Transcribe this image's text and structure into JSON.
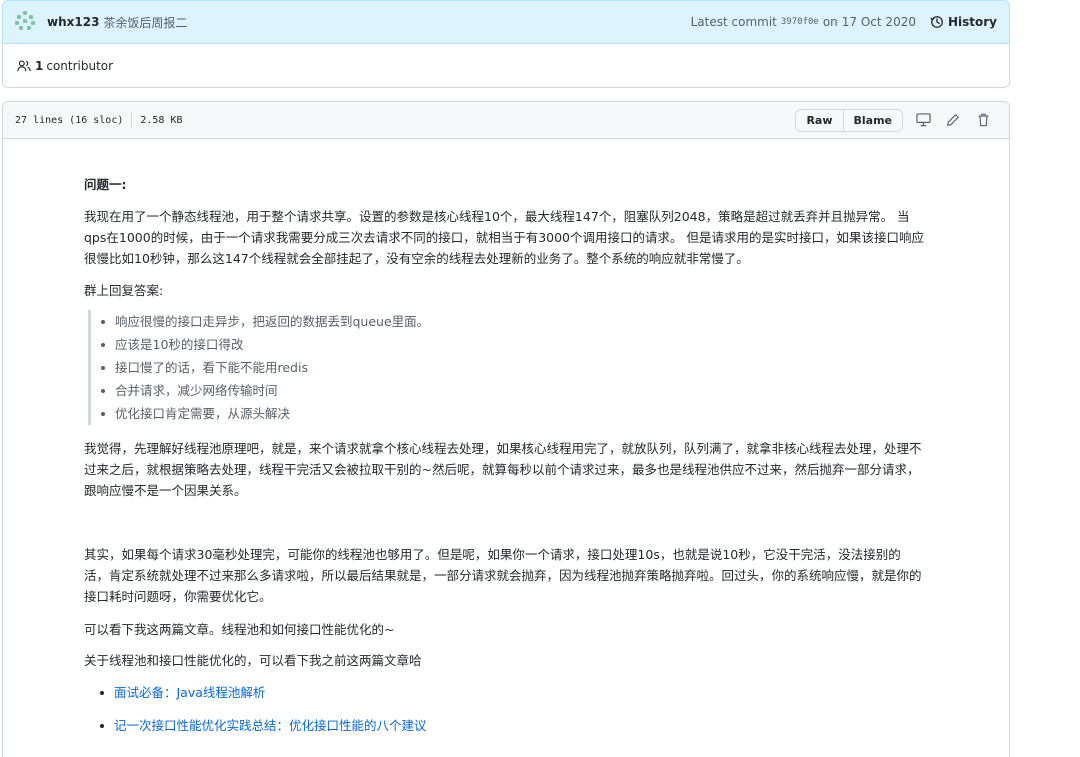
{
  "commit": {
    "author": "whx123",
    "message": "茶余饭后周报二",
    "latest_label": "Latest commit",
    "sha": "3970f0e",
    "date_prefix": "on",
    "date": "17 Oct 2020",
    "history_label": "History",
    "accent": "#ddf4ff"
  },
  "contributors": {
    "count": "1",
    "label": "contributor"
  },
  "file": {
    "lines": "27 lines (16 sloc)",
    "size": "2.58 KB",
    "raw_label": "Raw",
    "blame_label": "Blame",
    "icons": [
      "desktop-icon",
      "pencil-icon",
      "trash-icon"
    ]
  },
  "content": {
    "heading": "问题一:",
    "paragraph1": "我现在用了一个静态线程池，用于整个请求共享。设置的参数是核心线程10个，最大线程147个，阻塞队列2048，策略是超过就丢弃并且抛异常。 当qps在1000的时候，由于一个请求我需要分成三次去请求不同的接口，就相当于有3000个调用接口的请求。 但是请求用的是实时接口，如果该接口响应很慢比如10秒钟，那么这147个线程就会全部挂起了，没有空余的线程去处理新的业务了。整个系统的响应就非常慢了。",
    "paragraph2": "群上回复答案:",
    "quote_items": [
      "响应很慢的接口走异步，把返回的数据丢到queue里面。",
      "应该是10秒的接口得改",
      "接口慢了的话，看下能不能用redis",
      "合并请求，减少网络传输时间",
      "优化接口肯定需要，从源头解决"
    ],
    "paragraph3": "我觉得，先理解好线程池原理吧，就是，来个请求就拿个核心线程去处理，如果核心线程用完了，就放队列，队列满了，就拿非核心线程去处理，处理不过来之后，就根据策略去处理，线程干完活又会被拉取干别的~然后呢，就算每秒以前个请求过来，最多也是线程池供应不过来，然后抛弃一部分请求，跟响应慢不是一个因果关系。",
    "paragraph4": "其实，如果每个请求30毫秒处理完，可能你的线程池也够用了。但是呢，如果你一个请求，接口处理10s，也就是说10秒，它没干完活，没法接别的活，肯定系统就处理不过来那么多请求啦，所以最后结果就是，一部分请求就会抛弃，因为线程池抛弃策略抛弃啦。回过头，你的系统响应慢，就是你的接口耗时问题呀，你需要优化它。",
    "paragraph5": "可以看下我这两篇文章。线程池和如何接口性能优化的~",
    "paragraph6": "关于线程池和接口性能优化的，可以看下我之前这两篇文章哈",
    "links": [
      "面试必备：Java线程池解析",
      "记一次接口性能优化实践总结：优化接口性能的八个建议"
    ],
    "link_color": "#0969da"
  }
}
